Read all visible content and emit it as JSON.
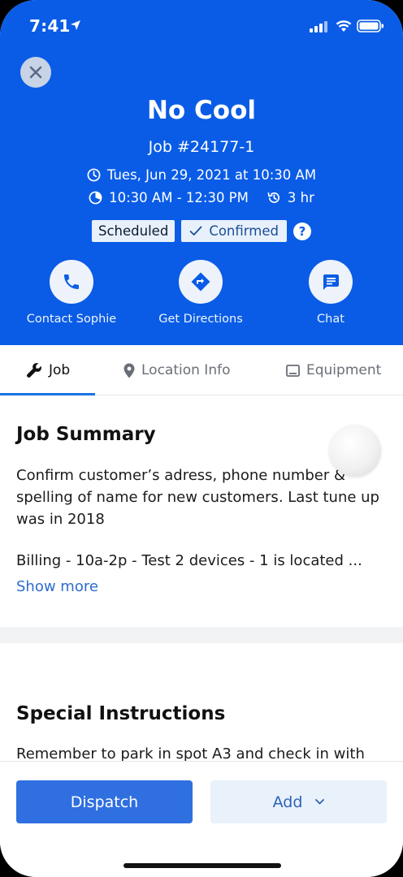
{
  "status_bar": {
    "time": "7:41"
  },
  "header": {
    "title": "No Cool",
    "job_number": "Job #24177-1",
    "date_time": "Tues, Jun 29, 2021 at 10:30 AM",
    "time_window": "10:30 AM - 12:30 PM",
    "duration": "3 hr",
    "badges": {
      "scheduled": "Scheduled",
      "confirmed": "Confirmed"
    },
    "help": "?"
  },
  "actions": [
    {
      "label": "Contact Sophie",
      "icon": "phone-icon"
    },
    {
      "label": "Get Directions",
      "icon": "directions-icon"
    },
    {
      "label": "Chat",
      "icon": "chat-icon"
    }
  ],
  "tabs": [
    {
      "label": "Job",
      "icon": "wrench-icon",
      "active": true
    },
    {
      "label": "Location Info",
      "icon": "location-pin-icon",
      "active": false
    },
    {
      "label": "Equipment",
      "icon": "tablet-icon",
      "active": false
    }
  ],
  "job_summary": {
    "title": "Job Summary",
    "text": "Confirm customer’s adress, phone number & spelling of name for new customers. Last tune up was in 2018",
    "billing": "Billing - 10a-2p - Test 2 devices - 1 is located ...",
    "show_more": "Show more"
  },
  "special_instructions": {
    "title": "Special Instructions",
    "text": "Remember to park in spot A3 and check in with"
  },
  "bottom_bar": {
    "dispatch_label": "Dispatch",
    "add_label": "Add"
  },
  "colors": {
    "header_blue": "#0a5ce6",
    "primary_button": "#2f6fe0",
    "link": "#2d6cce",
    "secondary_button_bg": "#e9f1fb"
  }
}
